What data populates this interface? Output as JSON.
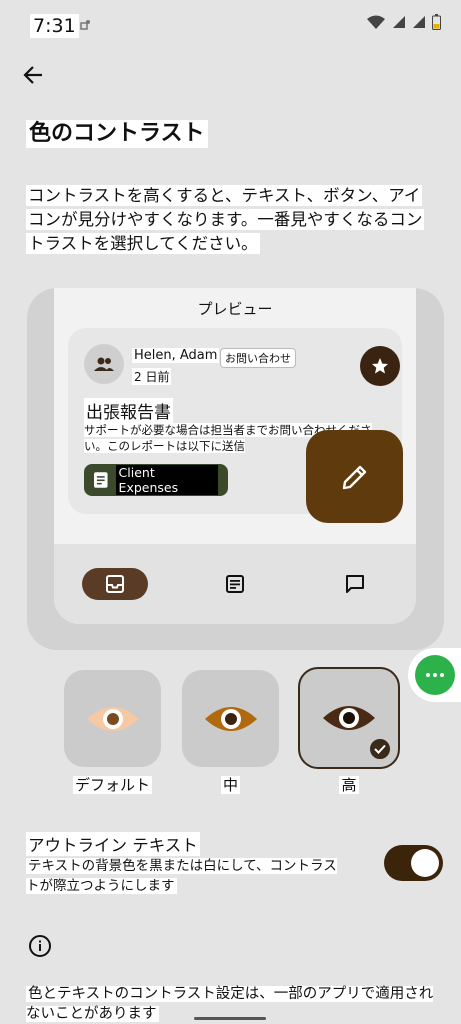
{
  "status_bar": {
    "time": "7:31"
  },
  "header": {
    "title": "色のコントラスト",
    "description": "コントラストを高くすると、テキスト、ボタン、アイコンが見分けやすくなります。一番見やすくなるコントラストを選択してください。"
  },
  "preview": {
    "title": "プレビュー",
    "email": {
      "sender": "Helen, Adam",
      "tag": "お問い合わせ",
      "date": "2 日前",
      "subject": "出張報告書",
      "snippet": "サポートが必要な場合は担当者までお問い合わせください。このレポートは以下に送信",
      "attachment_label": "Client Expenses"
    },
    "colors": {
      "accent_dark": "#3b2312",
      "fab": "#5e3a0d",
      "chip": "#3c4a2c"
    }
  },
  "contrast_options": [
    {
      "label": "デフォルト",
      "selected": false,
      "eye_color": "#f4c9a4",
      "pupil": "#7a4a20"
    },
    {
      "label": "中",
      "selected": false,
      "eye_color": "#b0690d",
      "pupil": "#3b2312"
    },
    {
      "label": "高",
      "selected": true,
      "eye_color": "#4a2a15",
      "pupil": "#1e0f05"
    }
  ],
  "outline_text": {
    "title": "アウトライン テキスト",
    "description": "テキストの背景色を黒または白にして、コントラストが際立つようにします",
    "enabled": true
  },
  "footer": {
    "note": "色とテキストのコントラスト設定は、一部のアプリで適用されないことがあります"
  }
}
